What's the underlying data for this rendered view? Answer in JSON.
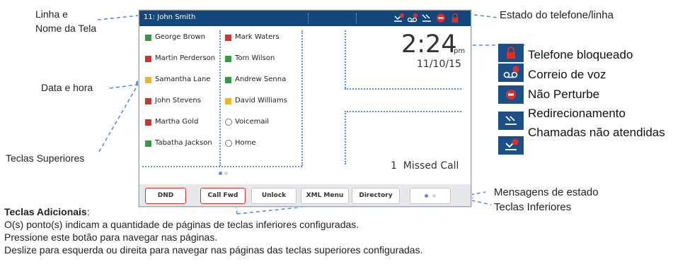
{
  "labels": {
    "line_name": "Linha e",
    "line_name2": "Nome da Tela",
    "date_time": "Data e hora",
    "top_keys": "Teclas Superiores",
    "phone_state": "Estado do telefone/linha",
    "status_messages": "Mensagens de estado",
    "bottom_keys": "Teclas Inferiores"
  },
  "screen": {
    "title": "11: John Smith",
    "time": "2:24",
    "ampm": "pm",
    "date": "11/10/15",
    "status_message": "1  Missed Call",
    "keys_left": [
      {
        "label": "George Brown",
        "color": "#2e9e3e"
      },
      {
        "label": "Martin Perderson",
        "color": "#d7312e"
      },
      {
        "label": "Samantha Lane",
        "color": "#f2b619"
      },
      {
        "label": "John Stevens",
        "color": "#d7312e"
      },
      {
        "label": "Martha Gold",
        "color": "#d7312e"
      },
      {
        "label": "Tabatha Jackson",
        "color": "#2e9e3e"
      }
    ],
    "keys_right": [
      {
        "label": "Mark Waters",
        "color": "#d7312e"
      },
      {
        "label": "Tom Wilson",
        "color": "#2e9e3e"
      },
      {
        "label": "Andrew Senna",
        "color": "#2e9e3e"
      },
      {
        "label": "David Williams",
        "color": "#f2b619"
      },
      {
        "label": "Voicemail",
        "color": "none"
      },
      {
        "label": "Home",
        "color": "none"
      }
    ],
    "softkeys": [
      "DND",
      "Call Fwd",
      "Unlock",
      "XML Menu",
      "Directory"
    ]
  },
  "legend": {
    "locked": "Telefone bloqueado",
    "voicemail": "Correio de voz",
    "dnd": "Não Perturbe",
    "forward": "Redirecionamento",
    "missed": "Chamadas não atendidas"
  },
  "notes": {
    "heading": "Teclas Adicionais",
    "colon": ":",
    "line1": "O(s) ponto(s) indicam a quantidade de páginas de teclas inferiores configuradas.",
    "line2": "Pressione este botão para navegar nas páginas.",
    "line3": "Deslize para esquerda ou direita para navegar nas páginas das teclas superiores configuradas."
  },
  "colors": {
    "titlebar": "#13477c",
    "accent_dots": "#5b8fd0",
    "red": "#d7312e",
    "green": "#2e9e3e",
    "yellow": "#f2b619"
  }
}
